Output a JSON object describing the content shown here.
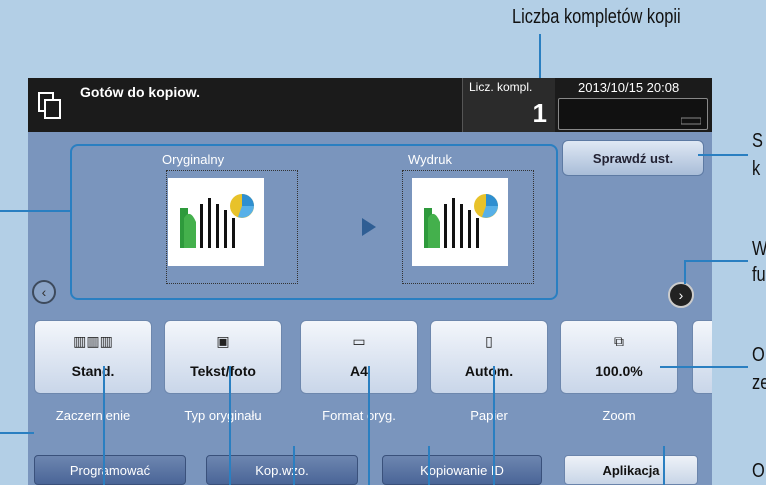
{
  "callouts": {
    "top": "Liczba kompletów kopii",
    "right_1_a": "S",
    "right_1_b": "k",
    "right_2_a": "W",
    "right_2_b": "fu",
    "right_3_a": "O",
    "right_3_b": "ze",
    "right_4_a": "O"
  },
  "status": {
    "message": "Gotów do kopiow.",
    "sets_label": "Licz. kompl.",
    "sets_value": "1",
    "datetime": "2013/10/15 20:08"
  },
  "preview": {
    "original_label": "Oryginalny",
    "output_label": "Wydruk",
    "check_button": "Sprawdź ust."
  },
  "nav": {
    "left": "‹",
    "right": "›"
  },
  "functions": [
    {
      "value": "Stand.",
      "label": "Zaczernienie",
      "icon": "density-icon"
    },
    {
      "value": "Tekst/foto",
      "label": "Typ oryginału",
      "icon": "original-type-icon"
    },
    {
      "value": "A4",
      "label": "Format oryg.",
      "icon": "original-size-icon"
    },
    {
      "value": "Autom.",
      "label": "Papier",
      "icon": "paper-icon"
    },
    {
      "value": "100.0%",
      "label": "Zoom",
      "icon": "zoom-icon"
    }
  ],
  "bottom_buttons": {
    "program": "Programować",
    "proof": "Kop.wzo.",
    "id_copy": "Kopiowanie ID",
    "apps": "Aplikacja"
  },
  "colors": {
    "accent_line": "#2a7fc1",
    "panel": "#7a95bd",
    "background": "#b3cfe6"
  }
}
